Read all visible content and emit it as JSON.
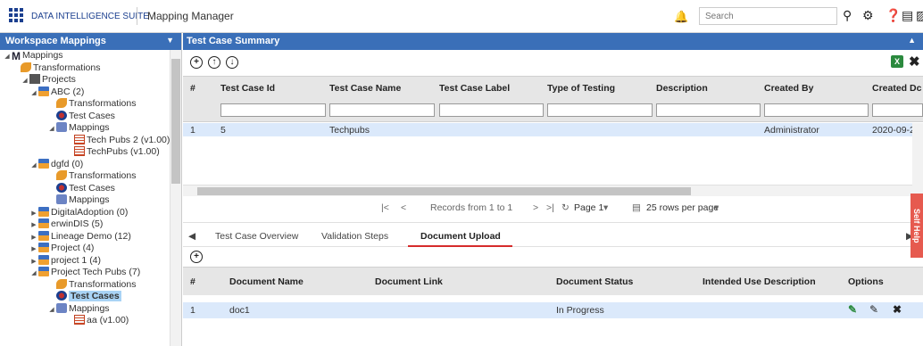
{
  "topbar": {
    "brand": "DATA INTELLIGENCE SUITE",
    "module": "Mapping Manager",
    "search_placeholder": "Search"
  },
  "left_panel": {
    "title": "Workspace Mappings",
    "tree": [
      {
        "label": "Mappings",
        "icon": "mappings-root-icon"
      },
      {
        "label": "Transformations",
        "icon": "transformations-icon"
      },
      {
        "label": "Projects",
        "icon": "projects-icon"
      },
      {
        "label": "ABC (2)",
        "icon": "project-icon"
      },
      {
        "label": "Transformations",
        "icon": "transformations-icon"
      },
      {
        "label": "Test Cases",
        "icon": "test-cases-icon"
      },
      {
        "label": "Mappings",
        "icon": "mappings-icon"
      },
      {
        "label": "Tech Pubs 2 (v1.00)",
        "icon": "mapping-table-icon"
      },
      {
        "label": "TechPubs (v1.00)",
        "icon": "mapping-table-icon"
      },
      {
        "label": "dgfd (0)",
        "icon": "project-icon"
      },
      {
        "label": "Transformations",
        "icon": "transformations-icon"
      },
      {
        "label": "Test Cases",
        "icon": "test-cases-icon"
      },
      {
        "label": "Mappings",
        "icon": "mappings-icon"
      },
      {
        "label": "DigitalAdoption (0)",
        "icon": "project-icon"
      },
      {
        "label": "erwinDIS (5)",
        "icon": "project-icon"
      },
      {
        "label": "Lineage Demo (12)",
        "icon": "project-icon"
      },
      {
        "label": "Project (4)",
        "icon": "project-icon"
      },
      {
        "label": "project 1 (4)",
        "icon": "project-icon"
      },
      {
        "label": "Project Tech Pubs (7)",
        "icon": "project-icon"
      },
      {
        "label": "Transformations",
        "icon": "transformations-icon"
      },
      {
        "label": "Test Cases",
        "icon": "test-cases-icon"
      },
      {
        "label": "Mappings",
        "icon": "mappings-icon"
      },
      {
        "label": "aa (v1.00)",
        "icon": "mapping-table-icon"
      }
    ]
  },
  "main": {
    "title": "Test Case Summary",
    "columns": [
      "#",
      "Test Case Id",
      "Test Case Name",
      "Test Case Label",
      "Type of Testing",
      "Description",
      "Created By",
      "Created Dc"
    ],
    "row": {
      "num": "1",
      "id": "5",
      "name": "Techpubs",
      "label": "",
      "type": "",
      "description": "",
      "created_by": "Administrator",
      "created_date": "2020-09-2"
    },
    "pager": {
      "records": "Records from 1 to 1",
      "page": "Page 1",
      "rows_per_page": "25 rows per page"
    }
  },
  "tabs": [
    "Test Case Overview",
    "Validation Steps",
    "Document Upload"
  ],
  "docs": {
    "columns": [
      "#",
      "Document Name",
      "Document Link",
      "Document Status",
      "Intended Use Description",
      "Options"
    ],
    "row": {
      "num": "1",
      "name": "doc1",
      "link": "",
      "status": "In Progress",
      "description": ""
    }
  },
  "side_tab": "Self Help"
}
